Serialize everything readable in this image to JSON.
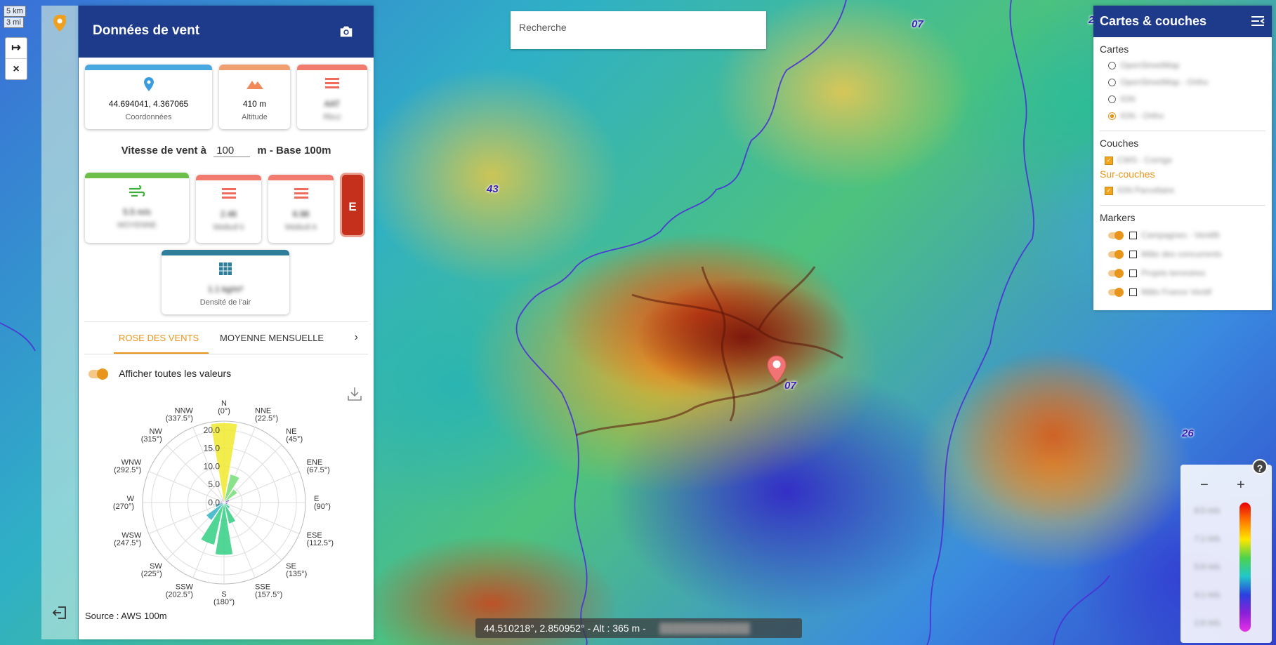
{
  "map": {
    "scale_km": "5 km",
    "scale_mi": "3 mi",
    "dept_labels": [
      "07",
      "43",
      "07",
      "26",
      "2"
    ],
    "search_placeholder": "Recherche",
    "coord_readout": "44.510218°, 2.850952° - Alt : 365 m -",
    "coord_extra": "█████████████",
    "controls": {
      "expand": "↦",
      "close": "×"
    }
  },
  "panel": {
    "title": "Données de vent",
    "cards_top": [
      {
        "icon": "location-pin-icon",
        "value": "44.694041, 4.367065",
        "label": "Coordonnées",
        "color": "#4aa8e0"
      },
      {
        "icon": "mountain-icon",
        "value": "410 m",
        "label": "Altitude",
        "color": "#f0a070"
      },
      {
        "icon": "list-icon",
        "value": "AAT",
        "label": "Rbcz",
        "color": "#f07b6e"
      }
    ],
    "speed": {
      "prefix": "Vitesse de vent à",
      "value": "100",
      "suffix": "m - Base 100m"
    },
    "cards_wind": [
      {
        "icon": "wind-icon",
        "value": "5.5 m/s",
        "label": "MOYENNE",
        "color": "#6cc04a"
      },
      {
        "icon": "list-icon",
        "value": "2.46",
        "label": "Weibull k",
        "color": "#f07b6e"
      },
      {
        "icon": "list-icon",
        "value": "6.98",
        "label": "Weibull A",
        "color": "#f07b6e"
      }
    ],
    "e_button": "E",
    "density_card": {
      "icon": "grid-icon",
      "value": "1.1 kg/m³",
      "label": "Densité de l'air",
      "color": "#2f7f9a"
    },
    "tabs": [
      "ROSE DES VENTS",
      "MOYENNE MENSUELLE"
    ],
    "toggle_label": "Afficher toutes les valeurs",
    "source": "Source : AWS 100m"
  },
  "layers": {
    "title": "Cartes & couches",
    "section_maps": "Cartes",
    "maps": [
      "OpenStreetMap",
      "OpenStreetMap - Ortho",
      "IGN",
      "IGN - Ortho"
    ],
    "selected_map_index": 3,
    "section_layers": "Couches",
    "layers": [
      "CWS - Corrige"
    ],
    "section_overlays": "Sur-couches",
    "overlays": [
      "IGN Parcellaire"
    ],
    "section_markers": "Markers",
    "markers": [
      "Campagnes - Ventifit",
      "Mâts des concurrents",
      "Projets terrestres",
      "Mâts France Ventif"
    ]
  },
  "legend": {
    "values": [
      "8.5 m/s",
      "7.1 m/s",
      "5.6 m/s",
      "4.1 m/s",
      "2.6 m/s"
    ]
  },
  "chart_data": {
    "type": "polar-bar",
    "title": "",
    "directions": [
      {
        "label": "N",
        "deg": "(0°)"
      },
      {
        "label": "NNE",
        "deg": "(22.5°)"
      },
      {
        "label": "NE",
        "deg": "(45°)"
      },
      {
        "label": "ENE",
        "deg": "(67.5°)"
      },
      {
        "label": "E",
        "deg": "(90°)"
      },
      {
        "label": "ESE",
        "deg": "(112.5°)"
      },
      {
        "label": "SE",
        "deg": "(135°)"
      },
      {
        "label": "SSE",
        "deg": "(157.5°)"
      },
      {
        "label": "S",
        "deg": "(180°)"
      },
      {
        "label": "SSW",
        "deg": "(202.5°)"
      },
      {
        "label": "SW",
        "deg": "(225°)"
      },
      {
        "label": "WSW",
        "deg": "(247.5°)"
      },
      {
        "label": "W",
        "deg": "(270°)"
      },
      {
        "label": "WNW",
        "deg": "(292.5°)"
      },
      {
        "label": "NW",
        "deg": "(315°)"
      },
      {
        "label": "NNW",
        "deg": "(337.5°)"
      }
    ],
    "values": [
      22.0,
      8.0,
      4.5,
      1.5,
      1.0,
      1.0,
      2.0,
      6.0,
      14.5,
      12.0,
      6.0,
      2.5,
      1.0,
      0.5,
      0.5,
      1.0
    ],
    "colors": [
      "#f2ea3a",
      "#7fe07f",
      "#7fe07f",
      "#9b59d6",
      "#9b59d6",
      "#9b59d6",
      "#3fc8a8",
      "#3fd28a",
      "#3fd28a",
      "#3fd28a",
      "#3fb8c8",
      "#3fa8c8",
      "#9b59d6",
      "#9b59d6",
      "#9b59d6",
      "#9b59d6"
    ],
    "rlim": [
      0,
      22.5
    ],
    "ticks": [
      "0.0",
      "5.0",
      "10.0",
      "15.0",
      "20.0"
    ],
    "tick_values": [
      0,
      5,
      10,
      15,
      20
    ]
  }
}
